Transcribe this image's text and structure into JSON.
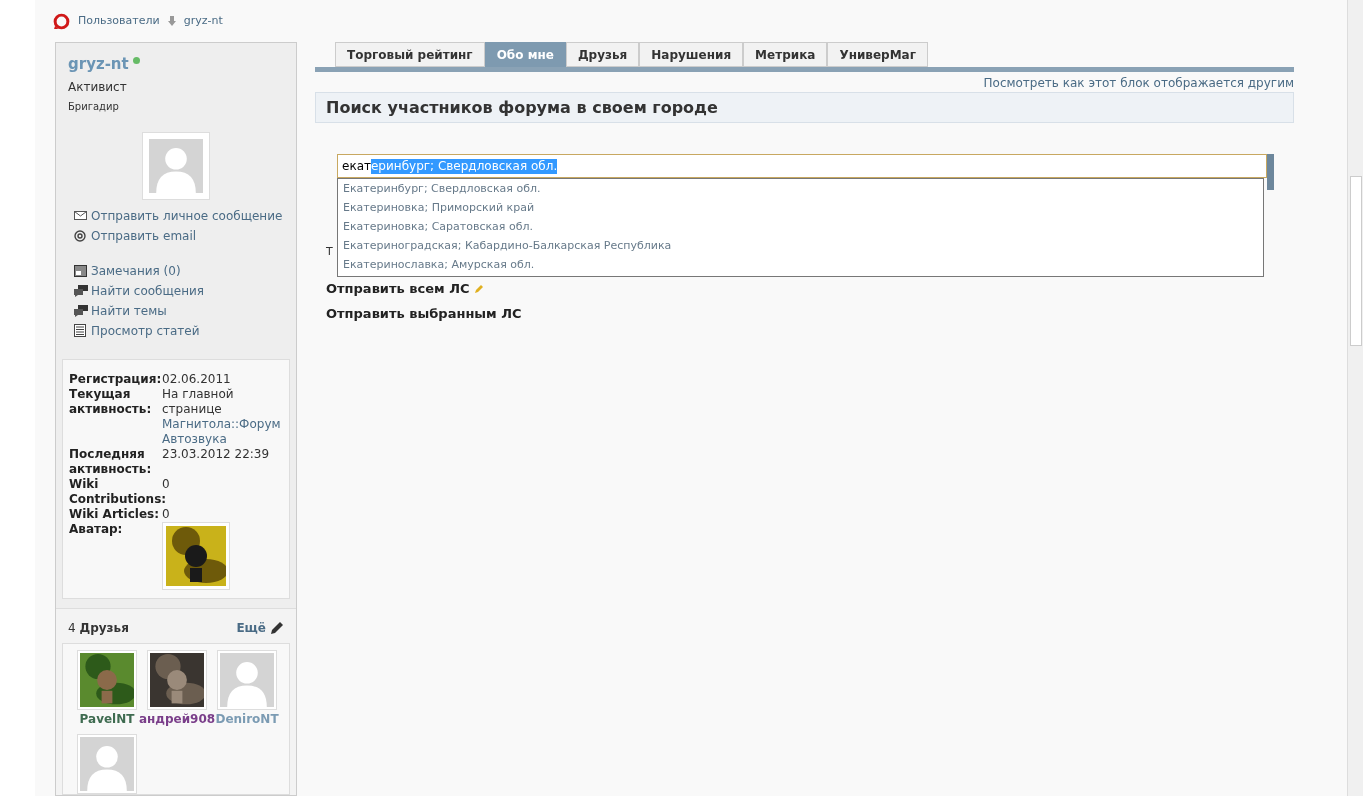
{
  "breadcrumb": [
    {
      "label": "Пользователи"
    },
    {
      "label": "gryz-nt"
    }
  ],
  "profile": {
    "username": "gryz-nt",
    "online": true,
    "rank": "Активист",
    "title": "Бригадир"
  },
  "action_groups": [
    [
      {
        "kind": "mail",
        "label": "Отправить личное сообщение"
      },
      {
        "kind": "email",
        "label": "Отправить email"
      }
    ],
    [
      {
        "kind": "notes",
        "label": "Замечания (0)"
      },
      {
        "kind": "chat",
        "label": "Найти сообщения"
      },
      {
        "kind": "chat",
        "label": "Найти темы"
      },
      {
        "kind": "doc",
        "label": "Просмотр статей"
      }
    ]
  ],
  "info": [
    {
      "label": "Регистрация:",
      "value": "02.06.2011"
    },
    {
      "label": "Текущая активность:",
      "value": "На главной странице",
      "link": "Магнитола::Форум Автозвука"
    },
    {
      "label": "Последняя активность:",
      "value": "23.03.2012 22:39"
    },
    {
      "label": "Wiki Contributions:",
      "value": "0"
    },
    {
      "label": "Wiki Articles:",
      "value": "0"
    },
    {
      "label": "Аватар:",
      "kind": "picture"
    }
  ],
  "friends": {
    "count": "4",
    "title": "Друзья",
    "more": "Ещё",
    "items": [
      {
        "name": "PavelNT",
        "color": "#3e6b50",
        "kind": "picture"
      },
      {
        "name": "андрей908",
        "color": "#7a3e8a",
        "kind": "picture"
      },
      {
        "name": "DeniroNT",
        "color": "#7b9bb3",
        "kind": "default"
      },
      {
        "kind": "default"
      }
    ]
  },
  "tabs": [
    {
      "label": "Торговый рейтинг",
      "selected": false
    },
    {
      "label": "Обо мне",
      "selected": true
    },
    {
      "label": "Друзья",
      "selected": false
    },
    {
      "label": "Нарушения",
      "selected": false
    },
    {
      "label": "Метрика",
      "selected": false
    },
    {
      "label": "УниверМаг",
      "selected": false
    }
  ],
  "view_as_others": "Посмотреть как этот блок отображается другим",
  "section_title": "Поиск участников форума в своем городе",
  "city_field": {
    "typed": "екат",
    "autocomplete": "еринбург; Свердловская обл."
  },
  "suggestions": [
    "Екатеринбург; Свердловская обл.",
    "Екатериновка; Приморский край",
    "Екатериновка; Саратовская обл.",
    "Екатериноградская; Кабардино-Балкарская Республика",
    "Екатеринославка; Амурская обл."
  ],
  "covered_text": "Т",
  "send_links": [
    {
      "label": "Отправить всем ЛС",
      "edit_icon": true
    },
    {
      "label": "Отправить выбранным ЛС",
      "edit_icon": false
    }
  ]
}
